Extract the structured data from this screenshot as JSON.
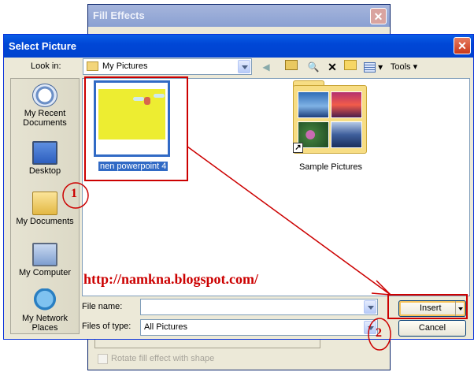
{
  "background_dialog": {
    "title": "Fill Effects",
    "close_glyph": "✕",
    "checkbox_label": "Rotate fill effect with shape"
  },
  "dialog": {
    "title": "Select Picture",
    "close_glyph": "✕",
    "look_in_label": "Look in:",
    "look_in_value": "My Pictures",
    "toolbar": {
      "back_icon": "back-icon",
      "up_folder_icon": "up-folder-icon",
      "search_icon": "search-web-icon",
      "delete_icon": "delete-icon",
      "new_folder_icon": "new-folder-icon",
      "views_icon": "views-icon",
      "tools_label": "Tools ▾",
      "delete_glyph": "✕",
      "search_glyph": "🔍",
      "back_glyph": "◀"
    },
    "places": [
      {
        "label": "My Recent Documents",
        "icon": "recent-documents-icon"
      },
      {
        "label": "Desktop",
        "icon": "desktop-icon"
      },
      {
        "label": "My Documents",
        "icon": "my-documents-icon"
      },
      {
        "label": "My Computer",
        "icon": "my-computer-icon"
      },
      {
        "label": "My Network Places",
        "icon": "network-places-icon"
      }
    ],
    "files": [
      {
        "name": "nen powerpoint 4",
        "type": "image",
        "selected": true
      },
      {
        "name": "Sample Pictures",
        "type": "folder-shortcut",
        "selected": false
      }
    ],
    "file_name_label": "File name:",
    "file_name_value": "",
    "files_of_type_label": "Files of type:",
    "files_of_type_value": "All Pictures",
    "insert_label": "Insert",
    "cancel_label": "Cancel"
  },
  "watermark": "http://namkna.blogspot.com/",
  "annotations": {
    "step1": "1",
    "step2": "2",
    "color": "#cc0000"
  }
}
